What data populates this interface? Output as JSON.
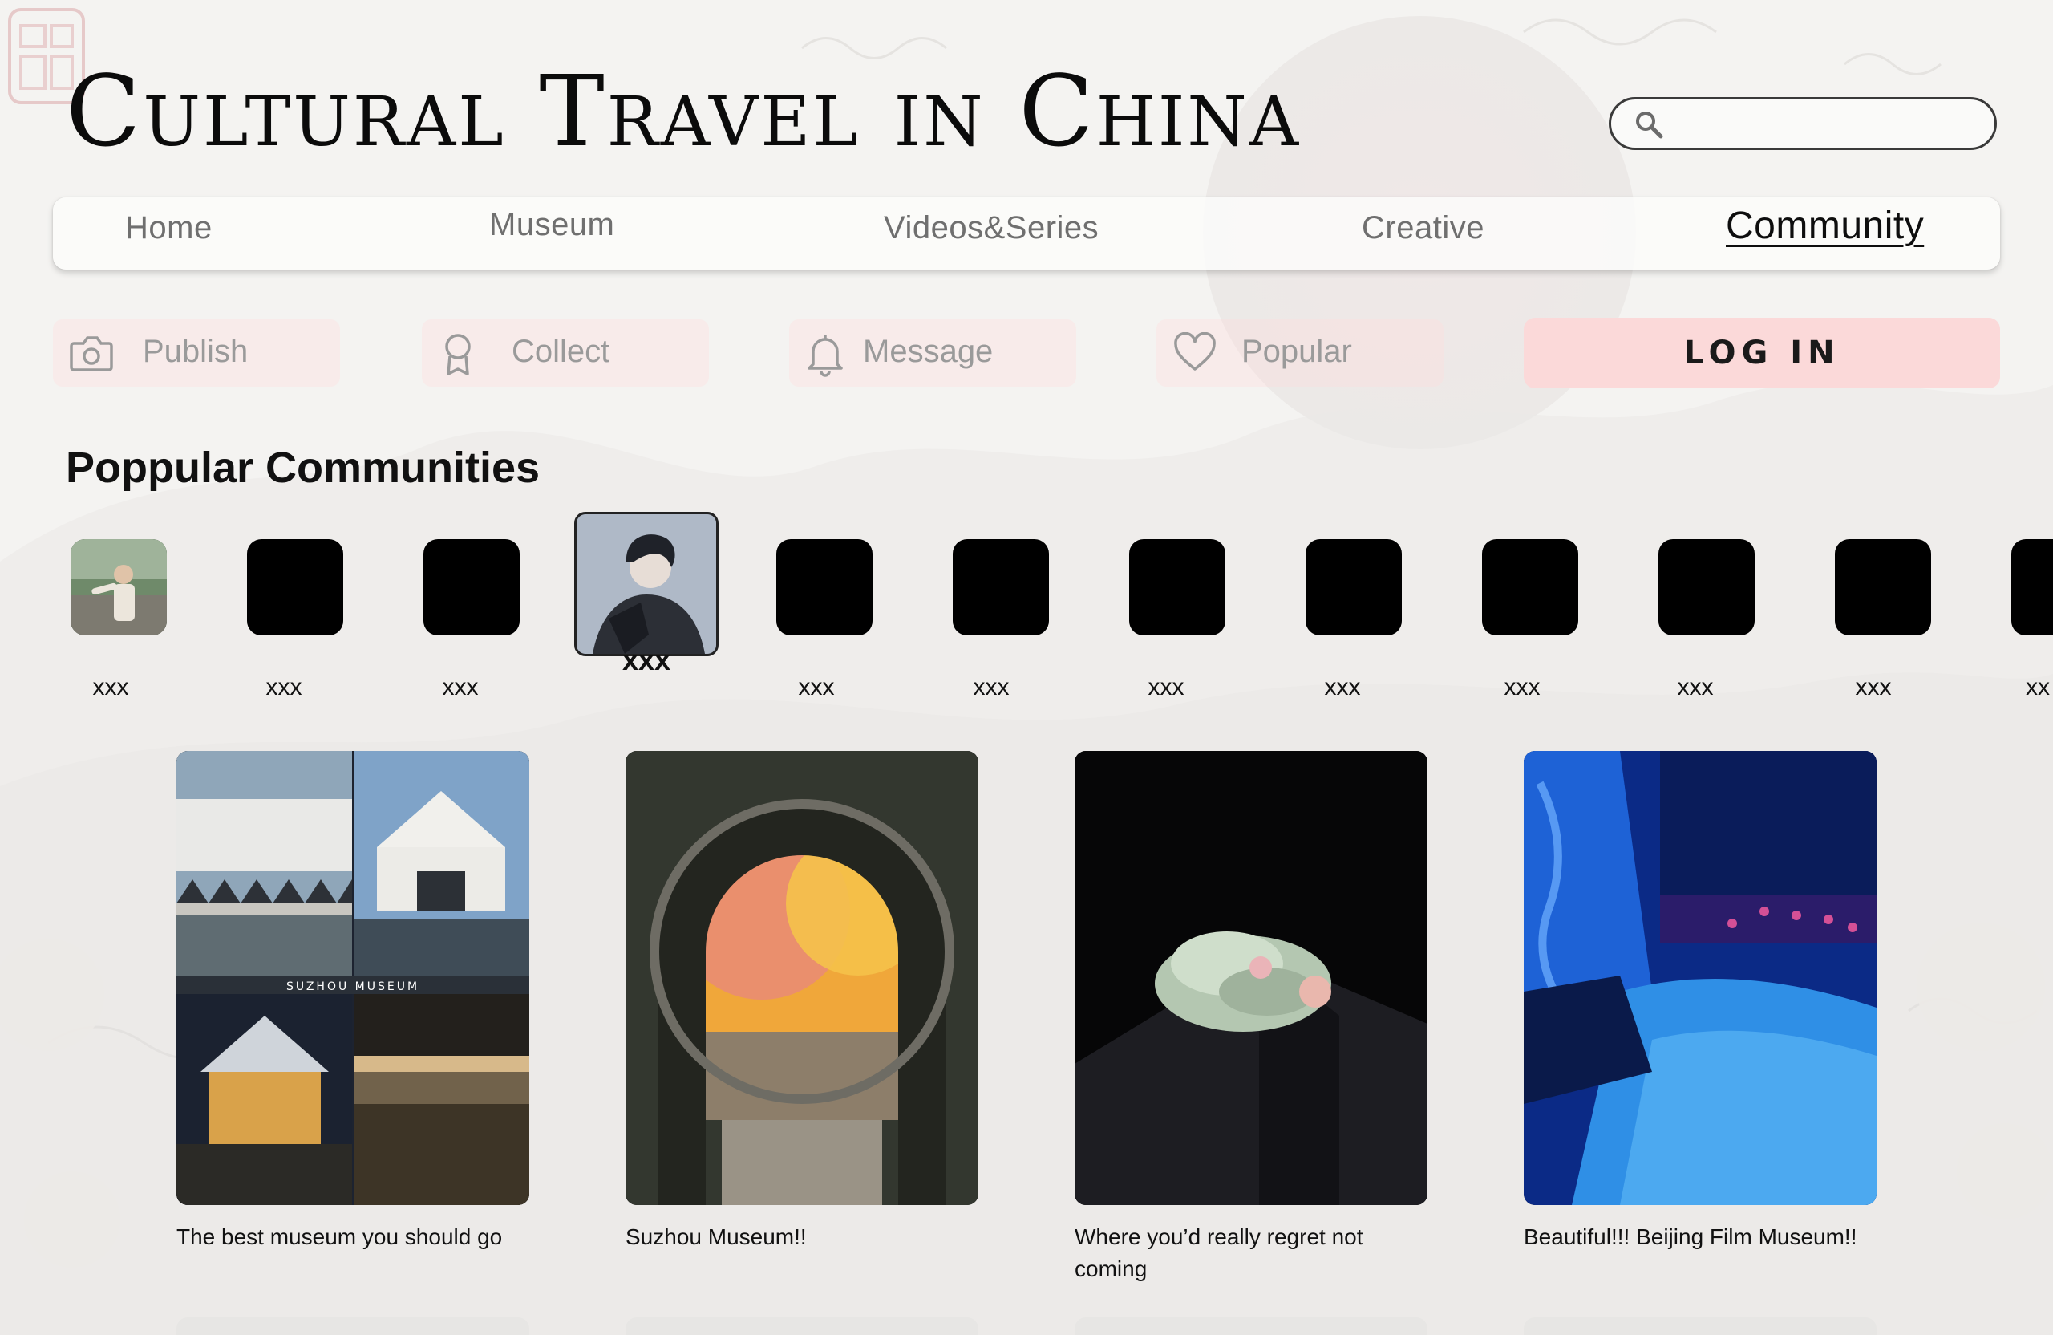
{
  "header": {
    "title": "Cultural Travel in China",
    "search": {
      "placeholder": "",
      "value": ""
    }
  },
  "nav": {
    "items": [
      {
        "label": "Home"
      },
      {
        "label": "Museum"
      },
      {
        "label": "Videos&Series"
      },
      {
        "label": "Creative"
      },
      {
        "label": "Community",
        "active": true
      }
    ]
  },
  "actions": {
    "publish": "Publish",
    "collect": "Collect",
    "message": "Message",
    "popular": "Popular",
    "login": "LOG IN"
  },
  "communities": {
    "heading": "Poppular Communities",
    "items": [
      {
        "name": "xxx",
        "avatar": "photo-child"
      },
      {
        "name": "xxx"
      },
      {
        "name": "xxx"
      },
      {
        "name": "xxx",
        "avatar": "photo-anime",
        "selected": true
      },
      {
        "name": "xxx"
      },
      {
        "name": "xxx"
      },
      {
        "name": "xxx"
      },
      {
        "name": "xxx"
      },
      {
        "name": "xxx"
      },
      {
        "name": "xxx"
      },
      {
        "name": "xxx"
      },
      {
        "name": "xx"
      }
    ]
  },
  "posts": [
    {
      "caption": "The best museum you should go",
      "image_text": "SUZHOU MUSEUM"
    },
    {
      "caption": "Suzhou Museum!!"
    },
    {
      "caption": "Where you’d really regret not coming"
    },
    {
      "caption": "Beautiful!!! Beijing Film Museum!!"
    }
  ],
  "colors": {
    "background": "#f4f3f1",
    "login_bg": "#fbd9d9",
    "action_bg": "#ffdede",
    "nav_inactive": "#6f6f6f",
    "nav_active": "#0e0e0e"
  }
}
